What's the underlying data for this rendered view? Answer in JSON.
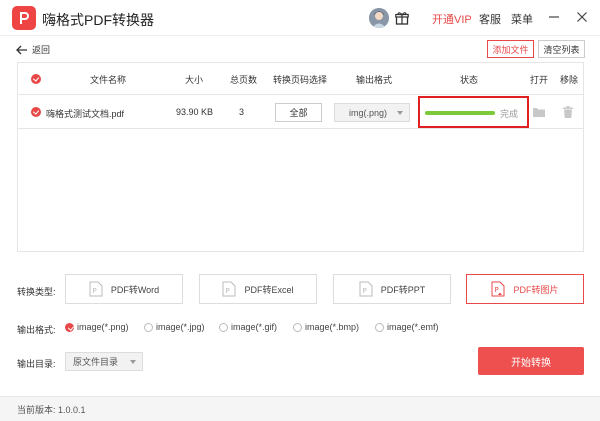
{
  "titlebar": {
    "app_title": "嗨格式PDF转换器",
    "vip_label": "开通VIP",
    "support_label": "客服",
    "menu_label": "菜单"
  },
  "toolbar": {
    "back_label": "返回",
    "add_file_label": "添加文件",
    "clear_list_label": "清空列表"
  },
  "table": {
    "headers": {
      "name": "文件名称",
      "size": "大小",
      "pages": "总页数",
      "page_select": "转换页码选择",
      "output_format": "输出格式",
      "status": "状态",
      "open": "打开",
      "remove": "移除"
    },
    "rows": [
      {
        "name": "嗨格式测试文档.pdf",
        "size": "93.90 KB",
        "pages": "3",
        "page_select": "全部",
        "output_format": "img(.png)",
        "progress": 1.0,
        "status": "完成"
      }
    ]
  },
  "conversion": {
    "label": "转换类型:",
    "types": [
      "PDF转Word",
      "PDF转Excel",
      "PDF转PPT",
      "PDF转图片"
    ],
    "active_index": 3
  },
  "output_format": {
    "label": "输出格式:",
    "options": [
      "image(*.png)",
      "image(*.jpg)",
      "image(*.gif)",
      "image(*.bmp)",
      "image(*.emf)"
    ],
    "selected_index": 0
  },
  "output_dir": {
    "label": "输出目录:",
    "value": "原文件目录"
  },
  "start_label": "开始转换",
  "footer": {
    "version": "当前版本: 1.0.0.1"
  },
  "colors": {
    "accent": "#e84848",
    "progress": "#7cc93a",
    "highlight_box": "#e02020"
  }
}
